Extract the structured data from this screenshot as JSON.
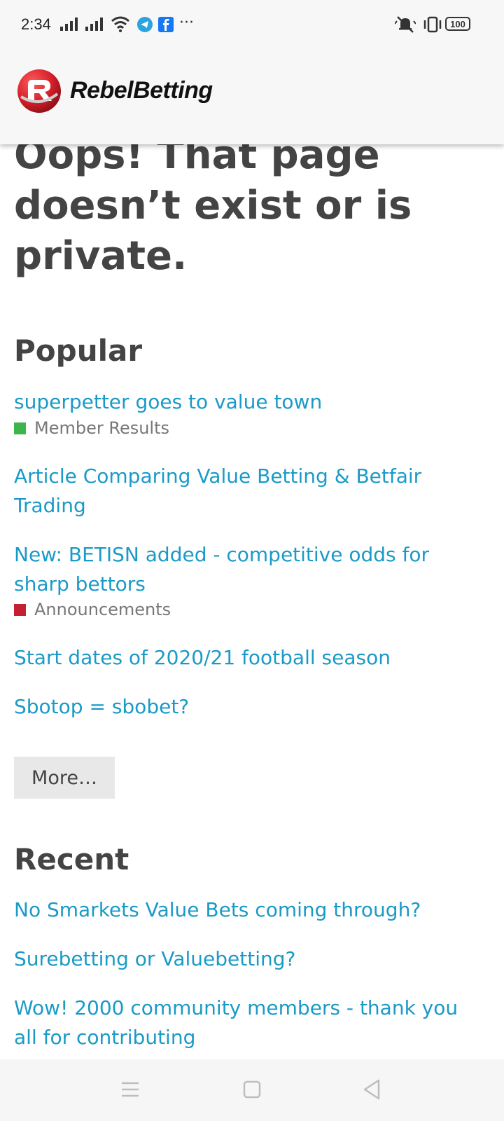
{
  "status": {
    "time": "2:34",
    "battery": "100"
  },
  "header": {
    "brand": "RebelBetting"
  },
  "page": {
    "title": "Oops! That page doesn’t exist or is private."
  },
  "popular": {
    "title": "Popular",
    "items": [
      {
        "title": "superpetter goes to value town",
        "category": "Member Results",
        "category_color": "#3cb54a"
      },
      {
        "title": "Article Comparing Value Betting & Betfair Trading"
      },
      {
        "title": "New: BETISN added - competitive odds for sharp bettors",
        "category": "Announcements",
        "category_color": "#c42031"
      },
      {
        "title": "Start dates of 2020/21 football season"
      },
      {
        "title": "Sbotop = sbobet?"
      }
    ],
    "more_label": "More…"
  },
  "recent": {
    "title": "Recent",
    "items": [
      {
        "title": "No Smarkets Value Bets coming through?"
      },
      {
        "title": "Surebetting or Valuebetting?"
      },
      {
        "title": "Wow! 2000 community members - thank you all for contributing"
      }
    ]
  },
  "colors": {
    "link": "#1a9ac7",
    "heading": "#444444",
    "brand_red": "#d4202a"
  },
  "icons": {
    "status": [
      "signal-icon",
      "wifi-icon",
      "telegram-icon",
      "facebook-icon",
      "more-dots-icon",
      "mute-icon",
      "vibrate-icon",
      "battery-icon"
    ],
    "nav": [
      "menu-icon",
      "home-icon",
      "back-icon"
    ]
  }
}
